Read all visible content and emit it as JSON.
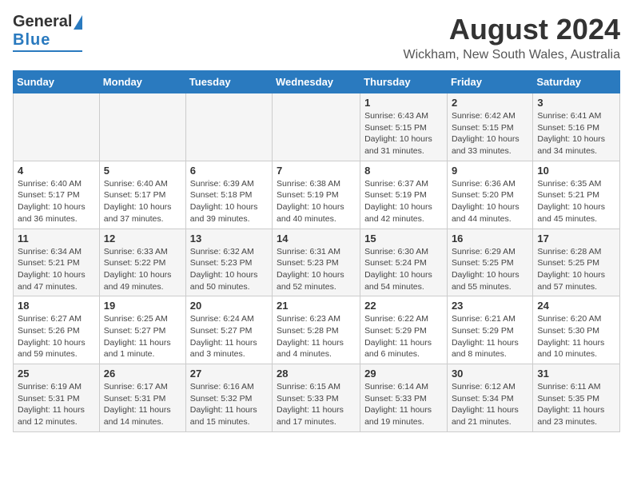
{
  "header": {
    "logo_general": "General",
    "logo_blue": "Blue",
    "month": "August 2024",
    "location": "Wickham, New South Wales, Australia"
  },
  "days_of_week": [
    "Sunday",
    "Monday",
    "Tuesday",
    "Wednesday",
    "Thursday",
    "Friday",
    "Saturday"
  ],
  "weeks": [
    [
      {
        "day": "",
        "info": ""
      },
      {
        "day": "",
        "info": ""
      },
      {
        "day": "",
        "info": ""
      },
      {
        "day": "",
        "info": ""
      },
      {
        "day": "1",
        "info": "Sunrise: 6:43 AM\nSunset: 5:15 PM\nDaylight: 10 hours and 31 minutes."
      },
      {
        "day": "2",
        "info": "Sunrise: 6:42 AM\nSunset: 5:15 PM\nDaylight: 10 hours and 33 minutes."
      },
      {
        "day": "3",
        "info": "Sunrise: 6:41 AM\nSunset: 5:16 PM\nDaylight: 10 hours and 34 minutes."
      }
    ],
    [
      {
        "day": "4",
        "info": "Sunrise: 6:40 AM\nSunset: 5:17 PM\nDaylight: 10 hours and 36 minutes."
      },
      {
        "day": "5",
        "info": "Sunrise: 6:40 AM\nSunset: 5:17 PM\nDaylight: 10 hours and 37 minutes."
      },
      {
        "day": "6",
        "info": "Sunrise: 6:39 AM\nSunset: 5:18 PM\nDaylight: 10 hours and 39 minutes."
      },
      {
        "day": "7",
        "info": "Sunrise: 6:38 AM\nSunset: 5:19 PM\nDaylight: 10 hours and 40 minutes."
      },
      {
        "day": "8",
        "info": "Sunrise: 6:37 AM\nSunset: 5:19 PM\nDaylight: 10 hours and 42 minutes."
      },
      {
        "day": "9",
        "info": "Sunrise: 6:36 AM\nSunset: 5:20 PM\nDaylight: 10 hours and 44 minutes."
      },
      {
        "day": "10",
        "info": "Sunrise: 6:35 AM\nSunset: 5:21 PM\nDaylight: 10 hours and 45 minutes."
      }
    ],
    [
      {
        "day": "11",
        "info": "Sunrise: 6:34 AM\nSunset: 5:21 PM\nDaylight: 10 hours and 47 minutes."
      },
      {
        "day": "12",
        "info": "Sunrise: 6:33 AM\nSunset: 5:22 PM\nDaylight: 10 hours and 49 minutes."
      },
      {
        "day": "13",
        "info": "Sunrise: 6:32 AM\nSunset: 5:23 PM\nDaylight: 10 hours and 50 minutes."
      },
      {
        "day": "14",
        "info": "Sunrise: 6:31 AM\nSunset: 5:23 PM\nDaylight: 10 hours and 52 minutes."
      },
      {
        "day": "15",
        "info": "Sunrise: 6:30 AM\nSunset: 5:24 PM\nDaylight: 10 hours and 54 minutes."
      },
      {
        "day": "16",
        "info": "Sunrise: 6:29 AM\nSunset: 5:25 PM\nDaylight: 10 hours and 55 minutes."
      },
      {
        "day": "17",
        "info": "Sunrise: 6:28 AM\nSunset: 5:25 PM\nDaylight: 10 hours and 57 minutes."
      }
    ],
    [
      {
        "day": "18",
        "info": "Sunrise: 6:27 AM\nSunset: 5:26 PM\nDaylight: 10 hours and 59 minutes."
      },
      {
        "day": "19",
        "info": "Sunrise: 6:25 AM\nSunset: 5:27 PM\nDaylight: 11 hours and 1 minute."
      },
      {
        "day": "20",
        "info": "Sunrise: 6:24 AM\nSunset: 5:27 PM\nDaylight: 11 hours and 3 minutes."
      },
      {
        "day": "21",
        "info": "Sunrise: 6:23 AM\nSunset: 5:28 PM\nDaylight: 11 hours and 4 minutes."
      },
      {
        "day": "22",
        "info": "Sunrise: 6:22 AM\nSunset: 5:29 PM\nDaylight: 11 hours and 6 minutes."
      },
      {
        "day": "23",
        "info": "Sunrise: 6:21 AM\nSunset: 5:29 PM\nDaylight: 11 hours and 8 minutes."
      },
      {
        "day": "24",
        "info": "Sunrise: 6:20 AM\nSunset: 5:30 PM\nDaylight: 11 hours and 10 minutes."
      }
    ],
    [
      {
        "day": "25",
        "info": "Sunrise: 6:19 AM\nSunset: 5:31 PM\nDaylight: 11 hours and 12 minutes."
      },
      {
        "day": "26",
        "info": "Sunrise: 6:17 AM\nSunset: 5:31 PM\nDaylight: 11 hours and 14 minutes."
      },
      {
        "day": "27",
        "info": "Sunrise: 6:16 AM\nSunset: 5:32 PM\nDaylight: 11 hours and 15 minutes."
      },
      {
        "day": "28",
        "info": "Sunrise: 6:15 AM\nSunset: 5:33 PM\nDaylight: 11 hours and 17 minutes."
      },
      {
        "day": "29",
        "info": "Sunrise: 6:14 AM\nSunset: 5:33 PM\nDaylight: 11 hours and 19 minutes."
      },
      {
        "day": "30",
        "info": "Sunrise: 6:12 AM\nSunset: 5:34 PM\nDaylight: 11 hours and 21 minutes."
      },
      {
        "day": "31",
        "info": "Sunrise: 6:11 AM\nSunset: 5:35 PM\nDaylight: 11 hours and 23 minutes."
      }
    ]
  ]
}
